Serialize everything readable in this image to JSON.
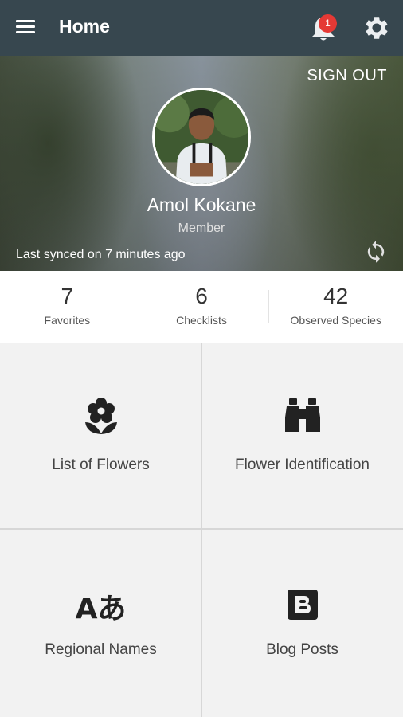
{
  "appbar": {
    "title": "Home",
    "menu_icon": "menu-icon",
    "notification_icon": "bell-icon",
    "notification_count": "1",
    "settings_icon": "gear-icon",
    "background_color": "#37474f"
  },
  "profile": {
    "sign_out_label": "SIGN OUT",
    "name": "Amol Kokane",
    "role": "Member",
    "last_synced": "Last synced on 7 minutes ago",
    "sync_icon": "refresh-icon"
  },
  "stats": [
    {
      "value": "7",
      "label": "Favorites"
    },
    {
      "value": "6",
      "label": "Checklists"
    },
    {
      "value": "42",
      "label": "Observed Species"
    }
  ],
  "tiles": [
    {
      "label": "List of Flowers",
      "icon": "flower-icon"
    },
    {
      "label": "Flower Identification",
      "icon": "binoculars-icon"
    },
    {
      "label": "Regional Names",
      "icon": "translate-icon",
      "glyph": "Aあ"
    },
    {
      "label": "Blog Posts",
      "icon": "blogger-icon"
    }
  ],
  "colors": {
    "badge": "#e53935",
    "grid_background": "#f2f2f2",
    "icon": "#222222"
  }
}
